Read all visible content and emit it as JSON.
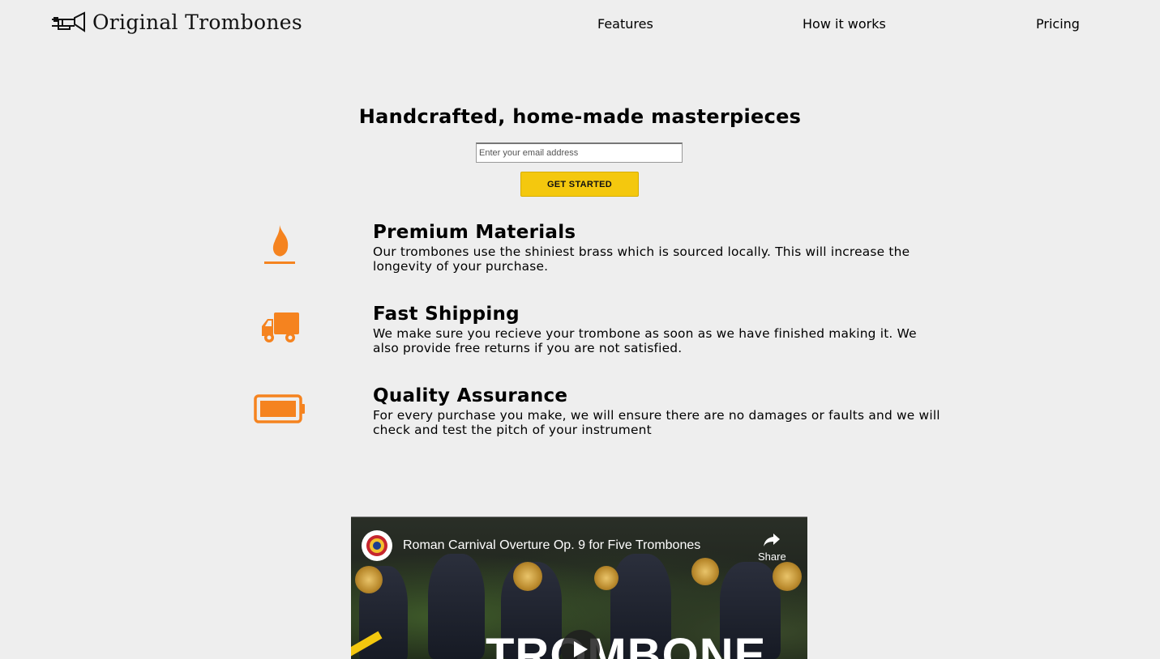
{
  "brand": {
    "name": "Original Trombones",
    "logo_icon": "trombone-icon"
  },
  "nav": {
    "items": [
      "Features",
      "How it works",
      "Pricing"
    ]
  },
  "hero": {
    "title": "Handcrafted, home-made masterpieces",
    "email_placeholder": "Enter your email address",
    "cta_label": "GET STARTED"
  },
  "features": [
    {
      "icon": "fire-icon",
      "title": "Premium Materials",
      "description": "Our trombones use the shiniest brass which is sourced locally. This will increase the longevity of your purchase."
    },
    {
      "icon": "truck-icon",
      "title": "Fast Shipping",
      "description": "We make sure you recieve your trombone as soon as we have finished making it. We also provide free returns if you are not satisfied."
    },
    {
      "icon": "battery-icon",
      "title": "Quality Assurance",
      "description": "For every purchase you make, we will ensure there are no damages or faults and we will check and test the pitch of your instrument"
    }
  ],
  "video": {
    "title": "Roman Carnival Overture Op. 9 for Five Trombones",
    "share_label": "Share",
    "overlay_text": "TROMBONE"
  },
  "colors": {
    "accent": "#f4c80e",
    "icon": "#f5831f",
    "background": "#eeeeee"
  }
}
